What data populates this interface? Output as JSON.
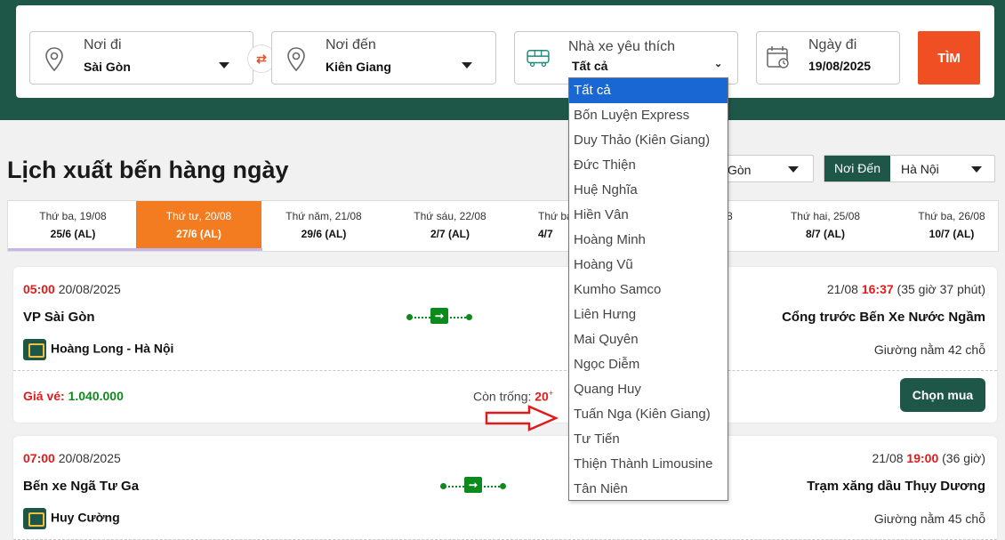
{
  "search": {
    "from": {
      "label": "Nơi đi",
      "value": "Sài Gòn",
      "icon": "location-pin-icon"
    },
    "swap_icon": "⇄",
    "to": {
      "label": "Nơi đến",
      "value": "Kiên Giang",
      "icon": "location-pin-icon"
    },
    "operator": {
      "label": "Nhà xe yêu thích",
      "value": "Tất cả",
      "icon": "bus-icon"
    },
    "date": {
      "label": "Ngày đi",
      "value": "19/08/2025",
      "icon": "calendar-icon"
    },
    "find_label": "TÌM"
  },
  "operator_options": [
    "Tất cả",
    "Bốn Luyện Express",
    "Duy Thảo (Kiên Giang)",
    "Đức Thiện",
    "Huệ Nghĩa",
    "Hiền Vân",
    "Hoàng Minh",
    "Hoàng Vũ",
    "Kumho Samco",
    "Liên Hưng",
    "Mai Quyên",
    "Ngọc Diễm",
    "Quang Huy",
    "Tuấn Nga (Kiên Giang)",
    "Tư Tiến",
    "Thiện Thành Limousine",
    "Tân Niên"
  ],
  "schedule": {
    "title": "Lịch xuất bến hàng ngày",
    "filter_from_value": "Gòn",
    "filter_to_tag": "Nơi Đến",
    "filter_to_value": "Hà Nội"
  },
  "days": [
    {
      "weekday": "Thứ ba, 19/08",
      "lunar": "25/6 (AL)"
    },
    {
      "weekday": "Thứ tư, 20/08",
      "lunar": "27/6 (AL)"
    },
    {
      "weekday": "Thứ năm, 21/08",
      "lunar": "29/6 (AL)"
    },
    {
      "weekday": "Thứ sáu, 22/08",
      "lunar": "2/7 (AL)"
    },
    {
      "weekday": "Thứ ba",
      "lunar": "4/7"
    },
    {
      "weekday": "8",
      "lunar": ""
    },
    {
      "weekday": "Thứ hai, 25/08",
      "lunar": "8/7 (AL)"
    },
    {
      "weekday": "Thứ ba, 26/08",
      "lunar": "10/7 (AL)"
    }
  ],
  "trips": [
    {
      "depart_time": "05:00",
      "depart_date": "20/08/2025",
      "arrive_date": "21/08",
      "arrive_time": "16:37",
      "duration": "(35 giờ 37 phút)",
      "from": "VP Sài Gòn",
      "to": "Cổng trước Bến Xe Nước Ngầm",
      "operator": "Hoàng Long - Hà Nội",
      "seat_type": "Giường nằm 42 chỗ",
      "price_label": "Giá vé:",
      "price": "1.040.000",
      "free_label": "Còn trống:",
      "free": "20",
      "free_sup": "+",
      "buy_label": "Chọn mua"
    },
    {
      "depart_time": "07:00",
      "depart_date": "20/08/2025",
      "arrive_date": "21/08",
      "arrive_time": "19:00",
      "duration": "(36 giờ)",
      "from": "Bến xe Ngã Tư Ga",
      "to": "Trạm xăng dầu Thụy Dương",
      "operator": "Huy Cường",
      "seat_type": "Giường nằm 45 chỗ"
    }
  ],
  "colors": {
    "brand_green": "#1e5648",
    "accent_orange": "#f47c20",
    "find_red": "#f04e23",
    "price_red": "#e01b1b",
    "price_green": "#0d8a1c",
    "select_blue": "#1967d2"
  }
}
